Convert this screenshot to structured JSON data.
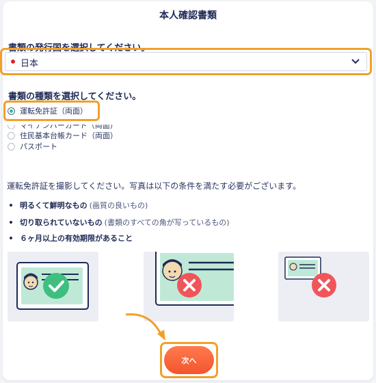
{
  "page": {
    "title": "本人確認書類"
  },
  "country": {
    "label": "書類の発行国を選択してください。",
    "selected": "日本"
  },
  "doc_type": {
    "label": "書類の種類を選択してください。",
    "options": [
      {
        "label": "運転免許証（両面）",
        "checked": true
      },
      {
        "label": "マイナンバーカード（両面）",
        "checked": false
      },
      {
        "label": "住民基本台帳カード（両面）",
        "checked": false
      },
      {
        "label": "パスポート",
        "checked": false
      }
    ]
  },
  "instructions": {
    "text": "運転免許証を撮影してください。写真は以下の条件を満たす必要がございます。",
    "items": [
      {
        "bold": "明るくて鮮明なもの",
        "note": "(画質の良いもの)"
      },
      {
        "bold": "切り取られていないもの",
        "note": "(書類のすべての角が写っているもの)"
      },
      {
        "bold": "６ヶ月以上の有効期限があること",
        "note": ""
      }
    ]
  },
  "examples": [
    {
      "icon": "check-icon"
    },
    {
      "icon": "cross-icon"
    },
    {
      "icon": "cross-icon"
    }
  ],
  "actions": {
    "next_label": "次へ"
  },
  "colors": {
    "accent": "#f4552e",
    "highlight": "#f0a02a",
    "teal": "#2bbfa0",
    "error": "#f0555a",
    "card_green": "#bfe9d6"
  }
}
